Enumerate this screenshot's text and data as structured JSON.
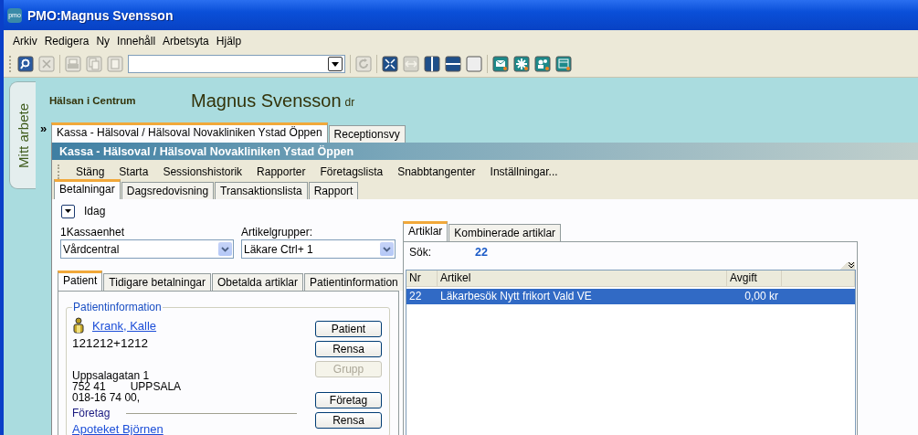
{
  "window": {
    "title": "PMO:Magnus Svensson",
    "logo": "pmo"
  },
  "menu": [
    "Arkiv",
    "Redigera",
    "Ny",
    "Innehåll",
    "Arbetsyta",
    "Hjälp"
  ],
  "side_tab": {
    "label": "Mitt arbete"
  },
  "header": {
    "clinic": "Hälsan i Centrum",
    "user": "Magnus Svensson",
    "user_title": "dr"
  },
  "expand_marker": "»",
  "doc_tabs": [
    {
      "label": "Kassa - Hälsoval / Hälsoval Novakliniken Ystad Öppen",
      "selected": true
    },
    {
      "label": "Receptionsvy",
      "selected": false
    }
  ],
  "panel_title": "Kassa - Hälsoval / Hälsoval Novakliniken Ystad Öppen",
  "commands": [
    "Stäng",
    "Starta",
    "Sessionshistorik",
    "Rapporter",
    "Företagslista",
    "Snabbtangenter",
    "Inställningar..."
  ],
  "sub_tabs": [
    {
      "label": "Betalningar",
      "selected": true
    },
    {
      "label": "Dagsredovisning",
      "selected": false
    },
    {
      "label": "Transaktionslista",
      "selected": false
    },
    {
      "label": "Rapport",
      "selected": false
    }
  ],
  "date_filter": {
    "label": "Idag"
  },
  "selectors": [
    {
      "label": "1Kassaenhet",
      "value": "Vårdcentral"
    },
    {
      "label": "Artikelgrupper:",
      "value": "Läkare Ctrl+ 1"
    }
  ],
  "patient_tabs": [
    {
      "label": "Patient",
      "selected": true
    },
    {
      "label": "Tidigare betalningar",
      "selected": false
    },
    {
      "label": "Obetalda artiklar",
      "selected": false
    },
    {
      "label": "Patientinformation",
      "selected": false
    }
  ],
  "patient_info": {
    "legend": "Patientinformation",
    "name": "Krank, Kalle",
    "id": "121212+1212",
    "address": "Uppsalagatan 1",
    "postal_code": "752 41",
    "city": "UPPSALA",
    "phone": "018-16 74 00,",
    "company_label": "Företag",
    "company": "Apoteket Björnen"
  },
  "buttons": [
    {
      "label": "Patient",
      "disabled": false
    },
    {
      "label": "Rensa",
      "disabled": false
    },
    {
      "label": "Grupp",
      "disabled": true
    },
    {
      "label": "Företag",
      "disabled": false
    },
    {
      "label": "Rensa",
      "disabled": false
    }
  ],
  "article_tabs": [
    {
      "label": "Artiklar",
      "selected": true
    },
    {
      "label": "Kombinerade artiklar",
      "selected": false
    }
  ],
  "search": {
    "label": "Sök:",
    "value": "22"
  },
  "table": {
    "columns": [
      "Nr",
      "Artikel",
      "Avgift"
    ],
    "rows": [
      {
        "cells": [
          "22",
          "Läkarbesök Nytt frikort Vald VE",
          "0,00 kr"
        ],
        "selected": true
      }
    ]
  }
}
